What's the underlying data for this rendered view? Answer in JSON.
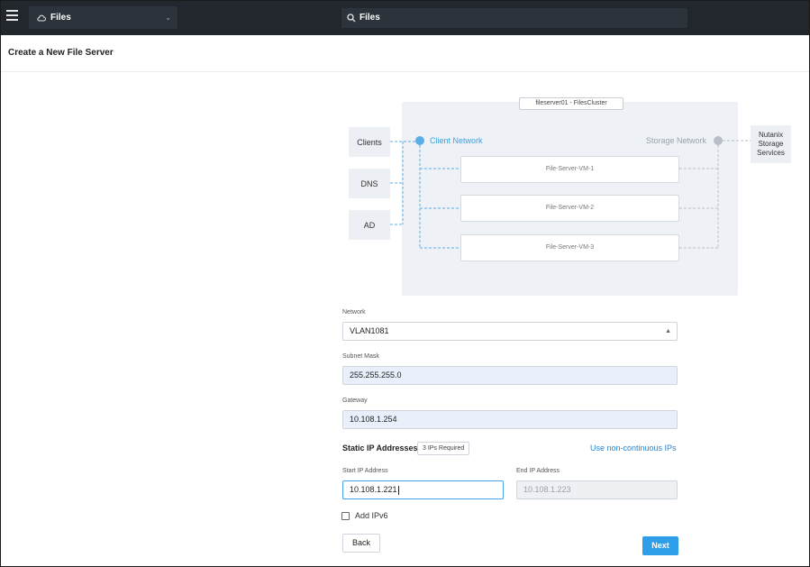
{
  "topbar": {
    "app_name": "Files",
    "app_icon": "cloud-icon",
    "search_value": "Files"
  },
  "page": {
    "title": "Create a New File Server"
  },
  "diagram": {
    "cluster_label": "fileserver01 - FilesCluster",
    "side_boxes": [
      "Clients",
      "DNS",
      "AD"
    ],
    "client_network": "Client Network",
    "storage_network": "Storage Network",
    "vms": [
      "File-Server-VM-1",
      "File-Server-VM-2",
      "File-Server-VM-3"
    ],
    "nutanix_lines": [
      "Nutanix",
      "Storage",
      "Services"
    ],
    "colors": {
      "client": "#5aaee8",
      "storage": "#b9bec6"
    }
  },
  "form": {
    "network_label": "Network",
    "network_value": "VLAN1081",
    "subnet_label": "Subnet Mask",
    "subnet_value": "255.255.255.0",
    "gateway_label": "Gateway",
    "gateway_value": "10.108.1.254",
    "static_title": "Static IP Addresses",
    "required_badge": "3 IPs Required",
    "noncontinuous_link": "Use non-continuous IPs",
    "start_label": "Start IP Address",
    "start_value": "10.108.1.221",
    "end_label": "End IP Address",
    "end_value": "10.108.1.223",
    "ipv6_label": "Add IPv6",
    "back_label": "Back",
    "next_label": "Next",
    "accent": "#2e9ee8"
  }
}
